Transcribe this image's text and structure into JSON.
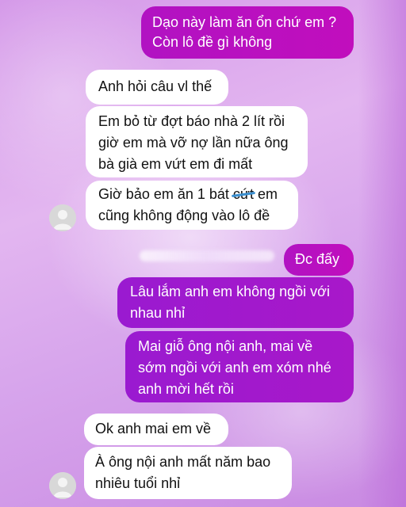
{
  "messages": [
    {
      "id": "m1",
      "direction": "outgoing",
      "lines": [
        "Dạo này làm ăn ổn chứ em ?",
        "Còn lô đề gì không"
      ]
    },
    {
      "id": "m2",
      "direction": "incoming",
      "lines": [
        "Anh hỏi câu vl thế"
      ]
    },
    {
      "id": "m3",
      "direction": "incoming",
      "lines": [
        "Em bỏ từ đợt báo nhà 2 lít rồi",
        "giờ em mà vỡ nợ lần nữa ông",
        "bà già em vứt em đi mất"
      ]
    },
    {
      "id": "m4",
      "direction": "incoming",
      "line1_before": "Giờ bảo em ăn 1 bát ",
      "line1_censored": "cứt",
      "line1_after": " em",
      "line2": "cũng không động vào lô đề"
    },
    {
      "id": "m5",
      "direction": "outgoing",
      "lines": [
        "Đc đấy"
      ]
    },
    {
      "id": "m6",
      "direction": "outgoing",
      "lines": [
        "Lâu lắm anh em không ngồi với",
        "nhau nhỉ"
      ]
    },
    {
      "id": "m7",
      "direction": "outgoing",
      "lines": [
        "Mai giỗ ông nội anh, mai về",
        "sớm ngồi với anh em xóm nhé",
        "anh mời hết rồi"
      ]
    },
    {
      "id": "m8",
      "direction": "incoming",
      "lines": [
        "Ok anh mai em về"
      ]
    },
    {
      "id": "m9",
      "direction": "incoming",
      "lines": [
        "À ông nội anh mất năm bao",
        "nhiêu tuổi nhỉ"
      ]
    }
  ],
  "colors": {
    "outgoing_magenta": "#b112c2",
    "outgoing_purple": "#9a1ad0",
    "incoming": "#ffffff"
  },
  "icons": {
    "avatar": "default-user-avatar-icon"
  }
}
